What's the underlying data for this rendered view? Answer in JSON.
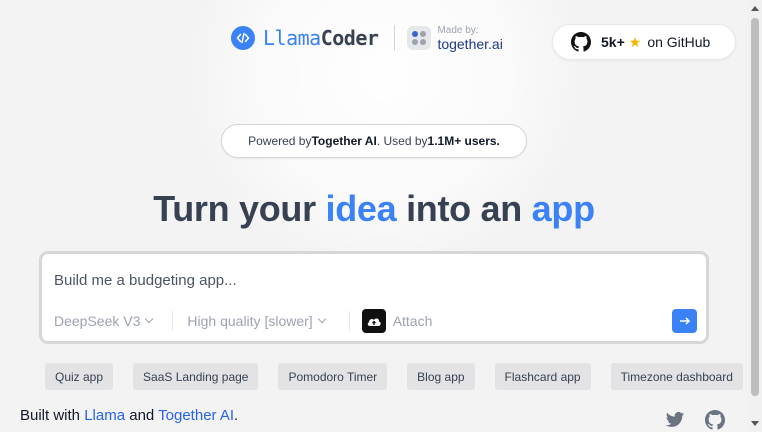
{
  "header": {
    "brand": {
      "part1": "Llama",
      "part2": "Coder"
    },
    "made_by": {
      "small": "Made by:",
      "name": "together.ai"
    },
    "github": {
      "count": "5k+",
      "label": "on GitHub",
      "star": "★"
    }
  },
  "powered": {
    "pre": "Powered by ",
    "brand": "Together AI",
    "mid": ". Used by ",
    "users": "1.1M+ users."
  },
  "headline": {
    "w1": "Turn your ",
    "w2": "idea",
    "w3": " into an ",
    "w4": "app"
  },
  "composer": {
    "placeholder": "Build me a budgeting app...",
    "model": "DeepSeek V3",
    "quality": "High quality [slower]",
    "attach": "Attach"
  },
  "chips": [
    "Quiz app",
    "SaaS Landing page",
    "Pomodoro Timer",
    "Blog app",
    "Flashcard app",
    "Timezone dashboard"
  ],
  "footer": {
    "pre": "Built with ",
    "llama": "Llama",
    "and": " and ",
    "together": "Together AI",
    "end": "."
  },
  "colors": {
    "accent": "#3b82f6",
    "background": "#f3f3f4",
    "star": "#f5b400"
  },
  "icons": [
    "code-logo-icon",
    "together-logo-icon",
    "github-icon",
    "star-icon",
    "upload-cloud-icon",
    "arrow-right-icon",
    "twitter-icon"
  ]
}
